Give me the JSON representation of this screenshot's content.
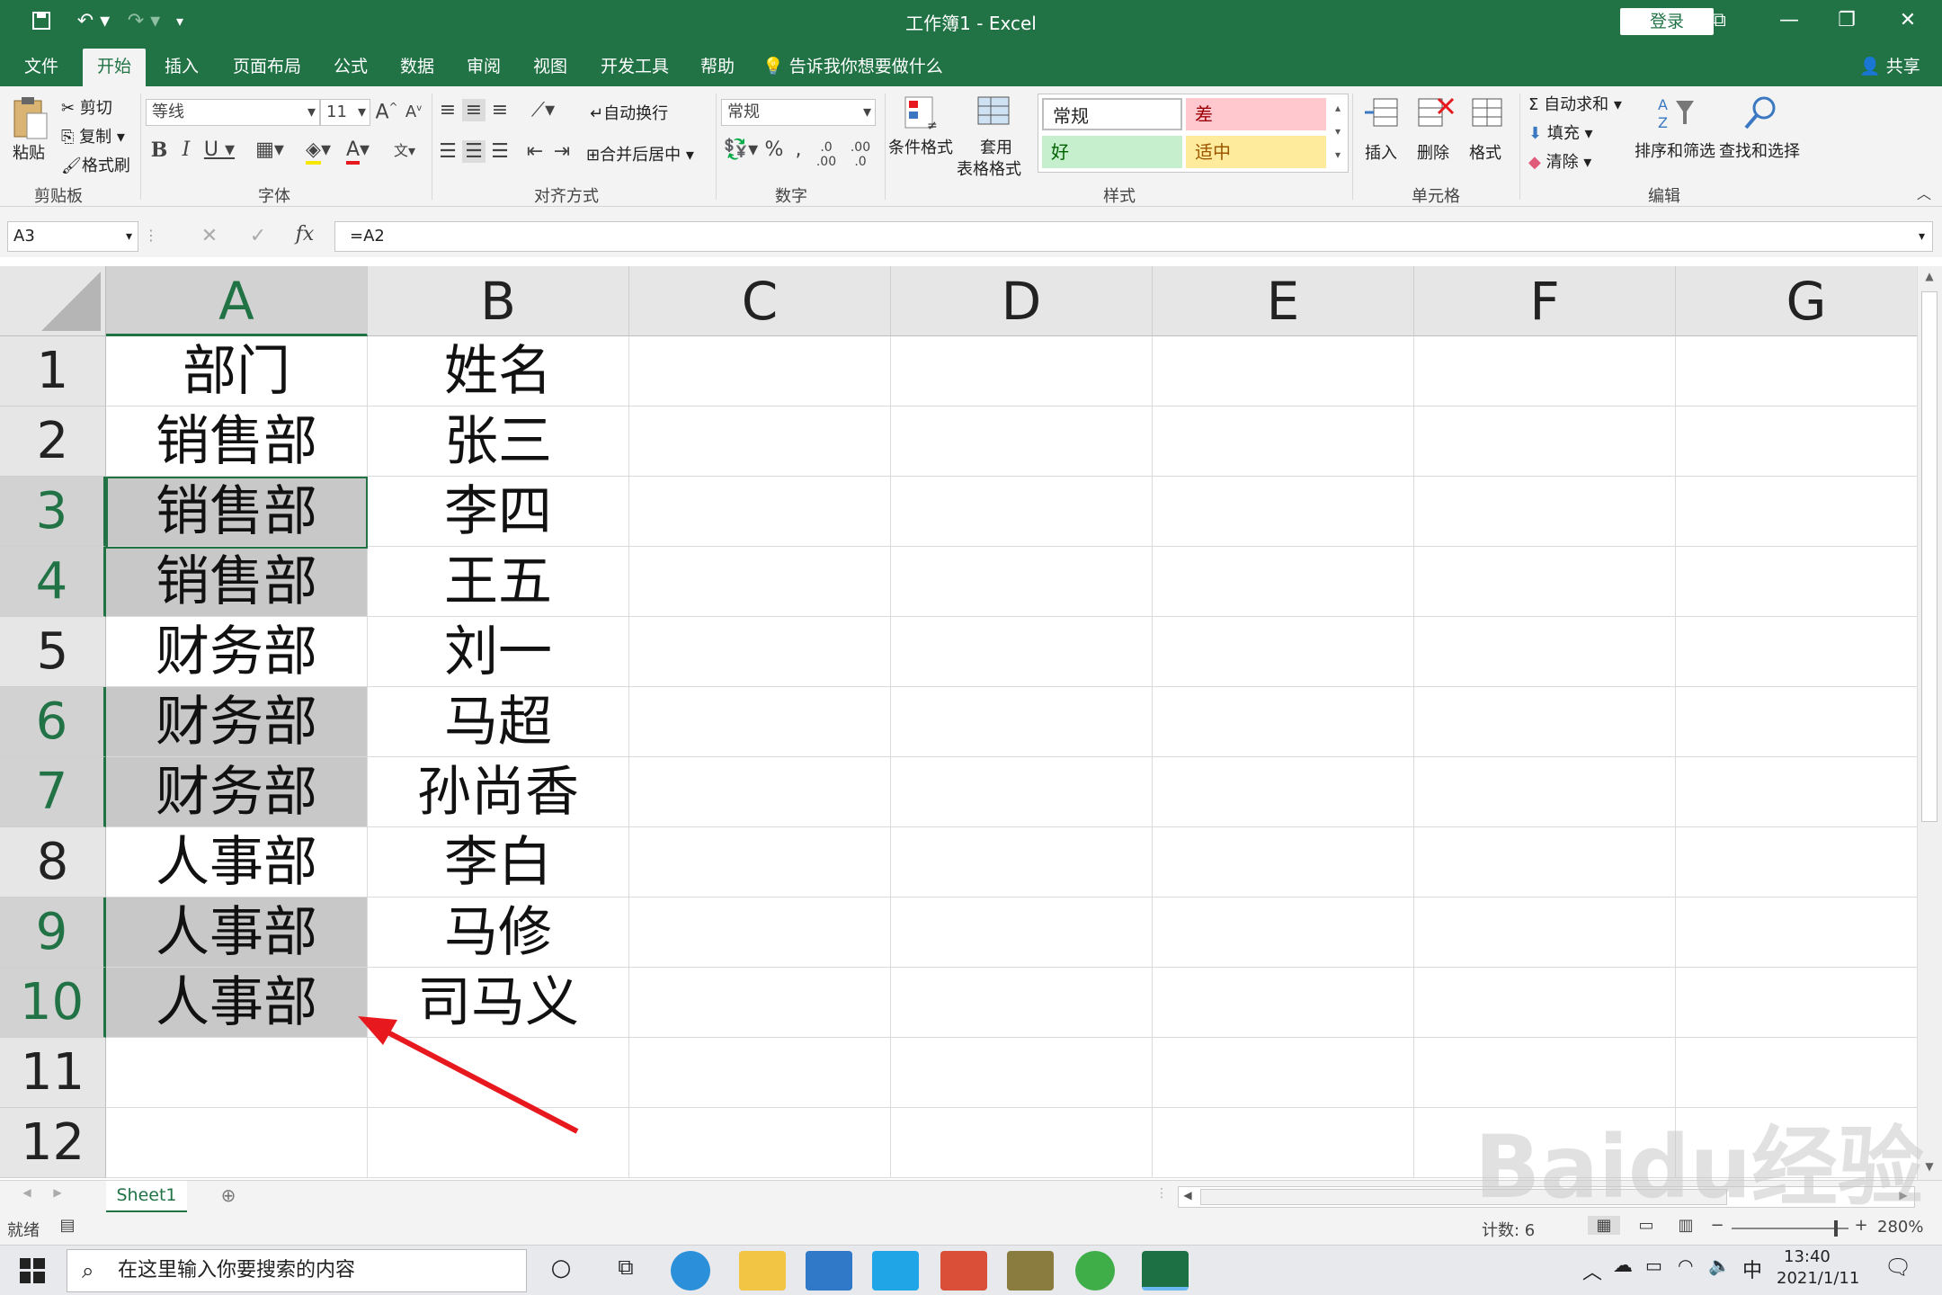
{
  "window": {
    "title": "工作簿1  -  Excel",
    "login": "登录"
  },
  "tabs": [
    "文件",
    "开始",
    "插入",
    "页面布局",
    "公式",
    "数据",
    "审阅",
    "视图",
    "开发工具",
    "帮助"
  ],
  "active_tab": "开始",
  "tell_me": "告诉我你想要做什么",
  "share": "共享",
  "ribbon": {
    "clipboard": {
      "paste": "粘贴",
      "cut": "剪切",
      "copy": "复制",
      "format_painter": "格式刷",
      "label": "剪贴板"
    },
    "font": {
      "name": "等线",
      "size": "11",
      "label": "字体"
    },
    "align": {
      "wrap": "自动换行",
      "merge": "合并后居中",
      "label": "对齐方式"
    },
    "number": {
      "format": "常规",
      "label": "数字"
    },
    "styles": {
      "cond": "条件格式",
      "table_line1": "套用",
      "table_line2": "表格格式",
      "normal": "常规",
      "bad": "差",
      "good": "好",
      "neutral": "适中",
      "label": "样式"
    },
    "cells": {
      "insert": "插入",
      "delete": "删除",
      "format": "格式",
      "label": "单元格"
    },
    "editing": {
      "autosum": "自动求和",
      "fill": "填充",
      "clear": "清除",
      "sort": "排序和筛选",
      "find": "查找和选择",
      "label": "编辑"
    }
  },
  "formula_bar": {
    "name_box": "A3",
    "formula": "=A2"
  },
  "columns": [
    "A",
    "B",
    "C",
    "D",
    "E",
    "F",
    "G"
  ],
  "rows": [
    {
      "n": "1",
      "a": "部门",
      "b": "姓名"
    },
    {
      "n": "2",
      "a": "销售部",
      "b": "张三"
    },
    {
      "n": "3",
      "a": "销售部",
      "b": "李四"
    },
    {
      "n": "4",
      "a": "销售部",
      "b": "王五"
    },
    {
      "n": "5",
      "a": "财务部",
      "b": "刘一"
    },
    {
      "n": "6",
      "a": "财务部",
      "b": "马超"
    },
    {
      "n": "7",
      "a": "财务部",
      "b": "孙尚香"
    },
    {
      "n": "8",
      "a": "人事部",
      "b": "李白"
    },
    {
      "n": "9",
      "a": "人事部",
      "b": "马修"
    },
    {
      "n": "10",
      "a": "人事部",
      "b": "司马义"
    },
    {
      "n": "11",
      "a": "",
      "b": ""
    },
    {
      "n": "12",
      "a": "",
      "b": ""
    }
  ],
  "sheet_tab": "Sheet1",
  "status": {
    "ready": "就绪",
    "count": "计数: 6",
    "zoom": "280%"
  },
  "taskbar": {
    "search": "在这里输入你要搜索的内容",
    "time": "13:40",
    "date": "2021/1/11",
    "ime": "中"
  },
  "watermark": "Baidu经验",
  "colors": {
    "excel_green": "#217346",
    "highlight": "#c8c8c8",
    "arrow": "#e8191e"
  }
}
